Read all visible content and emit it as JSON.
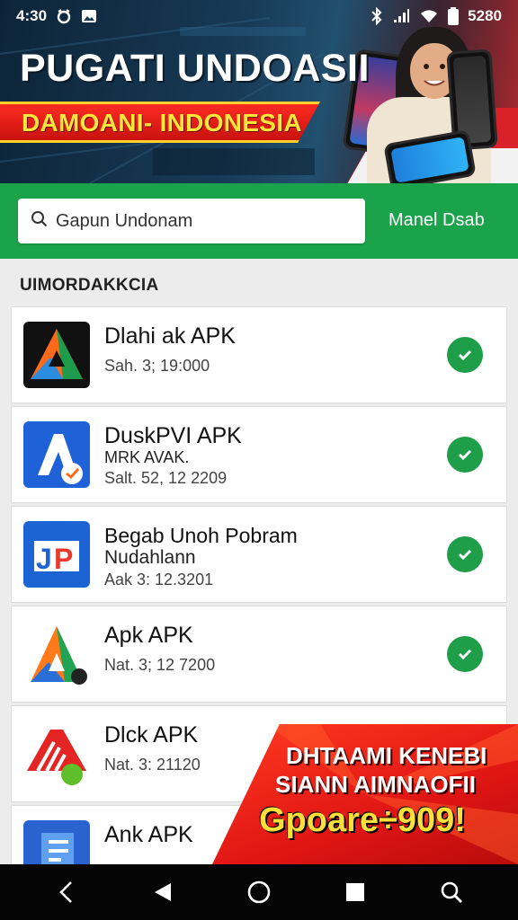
{
  "status_bar": {
    "time": "4:30",
    "battery_text": "5280",
    "icons": [
      "alarm-icon",
      "image-icon",
      "bluetooth-icon",
      "signal-icon",
      "wifi-icon",
      "battery-icon"
    ]
  },
  "banner": {
    "title": "PUGATI UNDOASII",
    "ribbon": "DAMOANI- INDONESIA"
  },
  "search": {
    "placeholder": "Gapun Undonam",
    "action_label": "Manel Dsab"
  },
  "section": {
    "title": "UIMORDAKKCIA"
  },
  "apps": [
    {
      "name": "Dlahi ak APK",
      "sub": "",
      "meta": "Sah. 3; 19:000",
      "icon": "a-logo-icon",
      "installed": true
    },
    {
      "name": "DuskPVI APK",
      "sub": "MRK AVAK.",
      "meta": "Salt. 52, 12 2209",
      "icon": "a-blue-logo-icon",
      "installed": true
    },
    {
      "name": "Begab Unoh Pobram",
      "sub": "Nudahlann",
      "meta": "Aak 3: 12.3201",
      "icon": "jp-logo-icon",
      "installed": true
    },
    {
      "name": "Apk APK",
      "sub": "",
      "meta": "Nat. 3; 12 7200",
      "icon": "a-triangle-logo-icon",
      "installed": true
    },
    {
      "name": "Dlck APK",
      "sub": "",
      "meta": "Nat. 3: 21120",
      "icon": "red-stripes-logo-icon",
      "installed": false
    },
    {
      "name": "Ank APK",
      "sub": "",
      "meta": "",
      "icon": "blue-doc-logo-icon",
      "installed": true
    }
  ],
  "promo": {
    "line1": "DHTAAMI KENEBI",
    "line2": "SIANN AIMNAOFII",
    "line3": "Gpoare÷909!"
  },
  "nav": [
    "back-icon",
    "triangle-back-icon",
    "home-icon",
    "recents-icon",
    "search-icon"
  ],
  "colors": {
    "accent_green": "#1aa34a",
    "check_green": "#1f9e4a",
    "banner_red": "#e01614",
    "banner_yellow": "#ffe03a"
  }
}
